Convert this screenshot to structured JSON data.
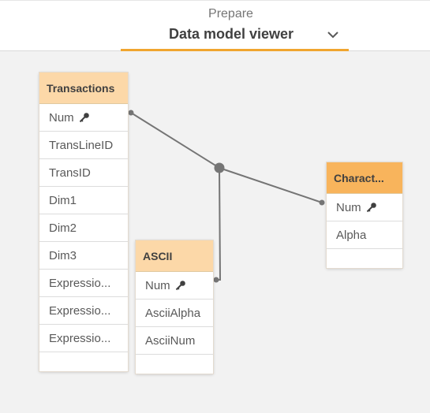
{
  "header": {
    "section_label": "Prepare",
    "title": "Data model viewer",
    "chevron_icon": "chevron-down-icon",
    "accent_color": "#f0a52f"
  },
  "tables": {
    "transactions": {
      "name": "Transactions",
      "fields": [
        "Num",
        "TransLineID",
        "TransID",
        "Dim1",
        "Dim2",
        "Dim3",
        "Expressio...",
        "Expressio...",
        "Expressio..."
      ]
    },
    "ascii": {
      "name": "ASCII",
      "fields": [
        "Num",
        "AsciiAlpha",
        "AsciiNum"
      ]
    },
    "characters": {
      "name": "Charact...",
      "fields": [
        "Num",
        "Alpha"
      ]
    }
  },
  "key_field": "Num",
  "key_icon": "key-icon",
  "colors": {
    "header_light": "#fcd8a8",
    "header_orange": "#f8b45c",
    "link_line": "#757575"
  }
}
